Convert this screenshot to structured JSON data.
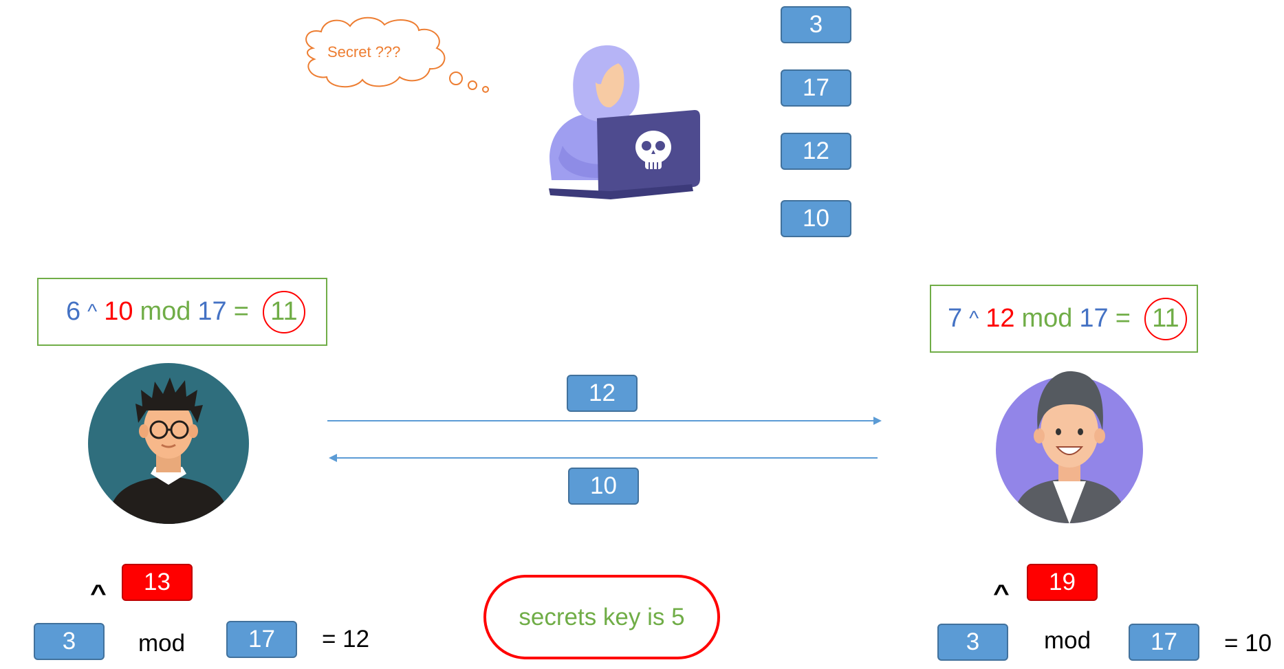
{
  "thought": {
    "text": "Secret ???"
  },
  "eve_values": [
    "3",
    "17",
    "12",
    "10"
  ],
  "left_equation": {
    "base": "6",
    "op": "^",
    "exp": "10",
    "mod": "mod",
    "modulus": "17",
    "eq": "=",
    "result": "11"
  },
  "right_equation": {
    "base": "7",
    "op": "^",
    "exp": "12",
    "mod": "mod",
    "modulus": "17",
    "eq": "=",
    "result": "11"
  },
  "exchange": {
    "to_right": "12",
    "to_left": "10"
  },
  "left_calc": {
    "caret": "^",
    "exponent": "13",
    "base": "3",
    "mod": "mod",
    "modulus": "17",
    "result": "= 12"
  },
  "right_calc": {
    "caret": "^",
    "exponent": "19",
    "base": "3",
    "mod": "mod",
    "modulus": "17",
    "result": "= 10"
  },
  "secret": {
    "text": "secrets key is 5"
  },
  "colors": {
    "blue_box": "#5b9bd5",
    "red_box": "#ff0000",
    "green": "#70ad47",
    "eq_blue": "#4472c4",
    "thought": "#ed7d31"
  },
  "icons": [
    "hacker-icon",
    "laptop-icon",
    "skull-icon",
    "alice-avatar-icon",
    "bob-avatar-icon",
    "thought-cloud-icon"
  ]
}
